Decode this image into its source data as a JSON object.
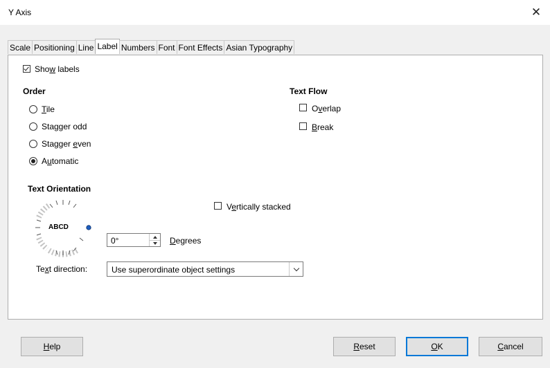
{
  "window": {
    "title": "Y Axis"
  },
  "tabs": [
    {
      "label": "Scale"
    },
    {
      "label": "Positioning"
    },
    {
      "label": "Line"
    },
    {
      "label": "Label"
    },
    {
      "label": "Numbers"
    },
    {
      "label": "Font"
    },
    {
      "label": "Font Effects"
    },
    {
      "label": "Asian Typography"
    }
  ],
  "active_tab": "Label",
  "show_labels": {
    "pre": "Sho",
    "u": "w",
    "post": " labels",
    "checked": true
  },
  "order": {
    "heading": "Order",
    "options": [
      {
        "pre": "",
        "u": "T",
        "post": "ile",
        "checked": false
      },
      {
        "pre": "Stagger odd",
        "u": "",
        "post": "",
        "checked": false
      },
      {
        "pre": "Stagger ",
        "u": "e",
        "post": "ven",
        "checked": false
      },
      {
        "pre": "A",
        "u": "u",
        "post": "tomatic",
        "checked": true
      }
    ]
  },
  "text_flow": {
    "heading": "Text Flow",
    "overlap": {
      "pre": "O",
      "u": "v",
      "post": "erlap",
      "checked": false
    },
    "break": {
      "pre": "",
      "u": "B",
      "post": "reak",
      "checked": false
    }
  },
  "text_orientation": {
    "heading": "Text Orientation",
    "dial_text": "ABCD",
    "vertically_stacked": {
      "pre": "V",
      "u": "e",
      "post": "rtically stacked",
      "checked": false
    },
    "degrees_value": "0°",
    "degrees_label": {
      "pre": "",
      "u": "D",
      "post": "egrees"
    },
    "text_direction_label": {
      "pre": "Te",
      "u": "x",
      "post": "t direction:"
    },
    "text_direction_value": "Use superordinate object settings"
  },
  "buttons": {
    "help": {
      "pre": "",
      "u": "H",
      "post": "elp"
    },
    "reset": {
      "pre": "",
      "u": "R",
      "post": "eset"
    },
    "ok": {
      "pre": "",
      "u": "O",
      "post": "K"
    },
    "cancel": {
      "pre": "",
      "u": "C",
      "post": "ancel"
    }
  },
  "icons": {
    "close": "close-icon",
    "check": "checkmark-icon",
    "dial": "rotation-dial-icon"
  },
  "colors": {
    "accent": "#0078d7",
    "dial_knob": "#1f5fbf"
  }
}
